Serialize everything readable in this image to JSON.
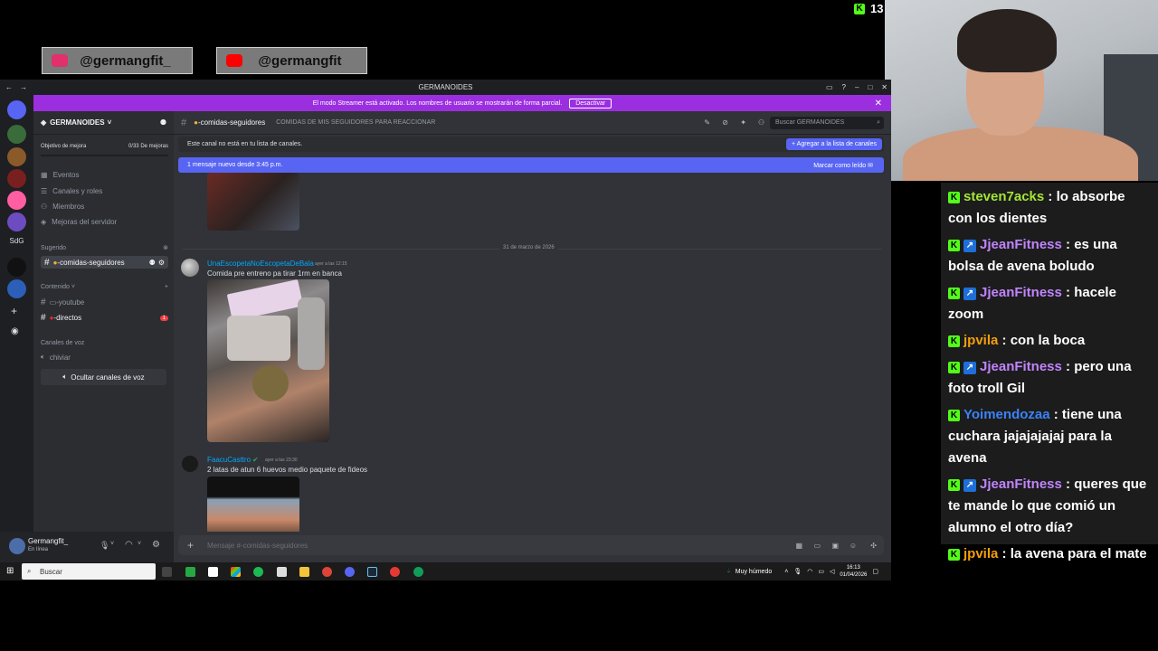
{
  "overlay": {
    "socials": [
      {
        "handle": "@germangfit_",
        "icon": "instagram-icon",
        "color": "#e1306c"
      },
      {
        "handle": "@germangfit",
        "icon": "youtube-icon",
        "color": "#ff0000"
      }
    ],
    "viewer_count": "13",
    "kick_badge": "K"
  },
  "chat": {
    "messages": [
      {
        "user": "steven7acks",
        "text": "lo absorbe con los dientes",
        "color": "#a3e635",
        "badges": [
          "K"
        ]
      },
      {
        "user": "JjeanFitness",
        "text": "es una bolsa de avena boludo",
        "color": "#c084fc",
        "badges": [
          "K",
          "S"
        ]
      },
      {
        "user": "JjeanFitness",
        "text": "hacele zoom",
        "color": "#c084fc",
        "badges": [
          "K",
          "S"
        ]
      },
      {
        "user": "jpvila",
        "text": "con la boca",
        "color": "#f59e0b",
        "badges": [
          "K"
        ]
      },
      {
        "user": "JjeanFitness",
        "text": "pero una foto troll Gil",
        "color": "#c084fc",
        "badges": [
          "K",
          "S"
        ]
      },
      {
        "user": "Yoimendozaa",
        "text": "tiene una cuchara jajajajajaj para la avena",
        "color": "#3b82f6",
        "badges": [
          "K"
        ]
      },
      {
        "user": "JjeanFitness",
        "text": "queres que te mande lo que comió un alumno el otro día?",
        "color": "#c084fc",
        "badges": [
          "K",
          "S"
        ]
      },
      {
        "user": "jpvila",
        "text": "la avena para el mate",
        "color": "#f59e0b",
        "badges": [
          "K"
        ]
      }
    ]
  },
  "discord": {
    "window_title": "GERMANOIDES",
    "streamer_banner": "El modo Streamer está activado. Los nombres de usuario se mostrarán de forma parcial.",
    "streamer_button": "Desactivar",
    "guild_name": "GERMANOIDES",
    "goal_label": "Objetivo de mejora",
    "goal_value": "0/33 De mejoras",
    "menu": [
      "Eventos",
      "Canales y roles",
      "Miembros",
      "Mejoras del servidor"
    ],
    "sections": {
      "suggested": "Sugerido",
      "content": "Contenido",
      "voice": "Canales de voz"
    },
    "channels": {
      "selected": "-comidas-seguidores",
      "youtube": "-youtube",
      "directos": "-directos",
      "directos_badge": "1",
      "voice": "chiviar",
      "hide_voice": "Ocultar canales de voz"
    },
    "topbar": {
      "channel": "-comidas-seguidores",
      "topic": "COMIDAS DE MIS SEGUIDORES PARA REACCIONAR",
      "search_placeholder": "Buscar GERMANOIDES"
    },
    "notice": {
      "text": "Este canal no está en tu lista de canales.",
      "button": "+ Agregar a la lista de canales"
    },
    "new_messages": {
      "text": "1 mensaje nuevo desde 3:45 p.m.",
      "button": "Marcar como leído"
    },
    "date_divider": "31 de marzo de 2026",
    "messages": [
      {
        "author": "UnaEscopetaNoEscopetaDeBala",
        "time": "ayer a las 12:15",
        "text": "Comida pre entreno pa tirar 1rm en banca"
      },
      {
        "author": "FaacuCasttro",
        "time": "ayer a las 23:30",
        "text": "2 latas de atun 6 huevos medio paquete de fideos"
      }
    ],
    "composer_placeholder": "Mensaje #-comidas-seguidores",
    "user": {
      "name": "Germangfit_",
      "status": "En línea"
    },
    "server_label": "SdG"
  },
  "taskbar": {
    "search": "Buscar",
    "weather": "Muy húmedo",
    "time": "16:13",
    "date": "01/04/2026"
  },
  "colors": {
    "discord_bg": "#313338",
    "blurple": "#5865f2",
    "streamer_purple": "#9b2fe0",
    "kick_green": "#53fc18"
  }
}
